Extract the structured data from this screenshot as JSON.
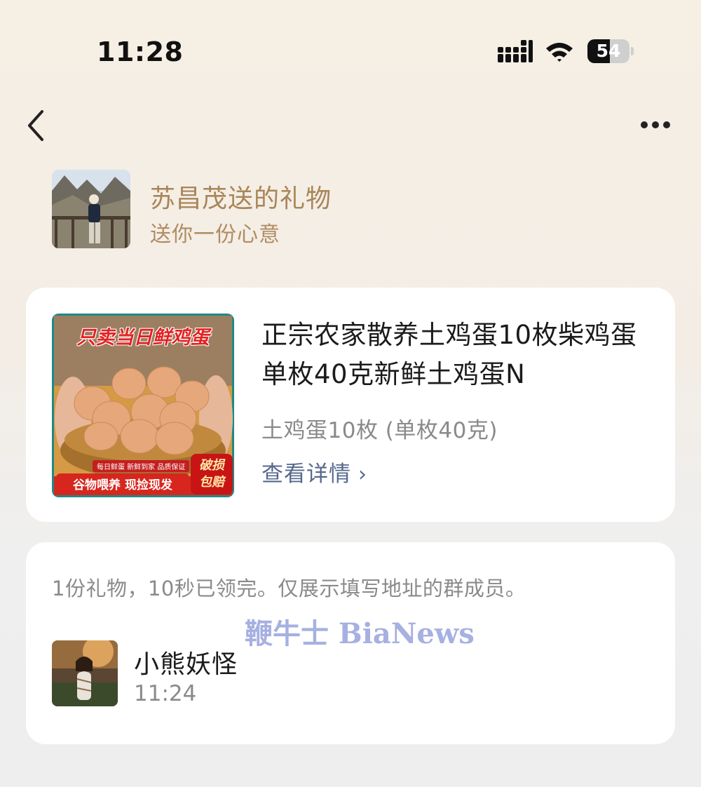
{
  "status_bar": {
    "time": "11:28",
    "battery_percent": 54,
    "battery_label": "54"
  },
  "nav": {
    "back_icon": "chevron-left-icon",
    "more_icon": "ellipsis-icon"
  },
  "gift": {
    "title": "苏昌茂送的礼物",
    "subtitle": "送你一份心意"
  },
  "product": {
    "title": "正宗农家散养土鸡蛋10枚柴鸡蛋单枚40克新鲜土鸡蛋N",
    "spec": "土鸡蛋10枚 (单枚40克)",
    "detail_label": "查看详情",
    "image_text": {
      "top_banner": "只卖当日鲜鸡蛋",
      "small_banner": "每日鲜蛋 新鲜到家 品质保证",
      "bottom_banner": "谷物喂养 现捡现发",
      "badge_line1": "破损",
      "badge_line2": "包赔"
    }
  },
  "claims": {
    "summary": "1份礼物，10秒已领完。仅展示填写地址的群成员。",
    "watermark": "鞭牛士 BiaNews",
    "recipients": [
      {
        "name": "小熊妖怪",
        "time": "11:24"
      }
    ]
  },
  "colors": {
    "accent_gold": "#a98558",
    "link_blue": "#56688d",
    "muted_gray": "#8a8a8a"
  }
}
